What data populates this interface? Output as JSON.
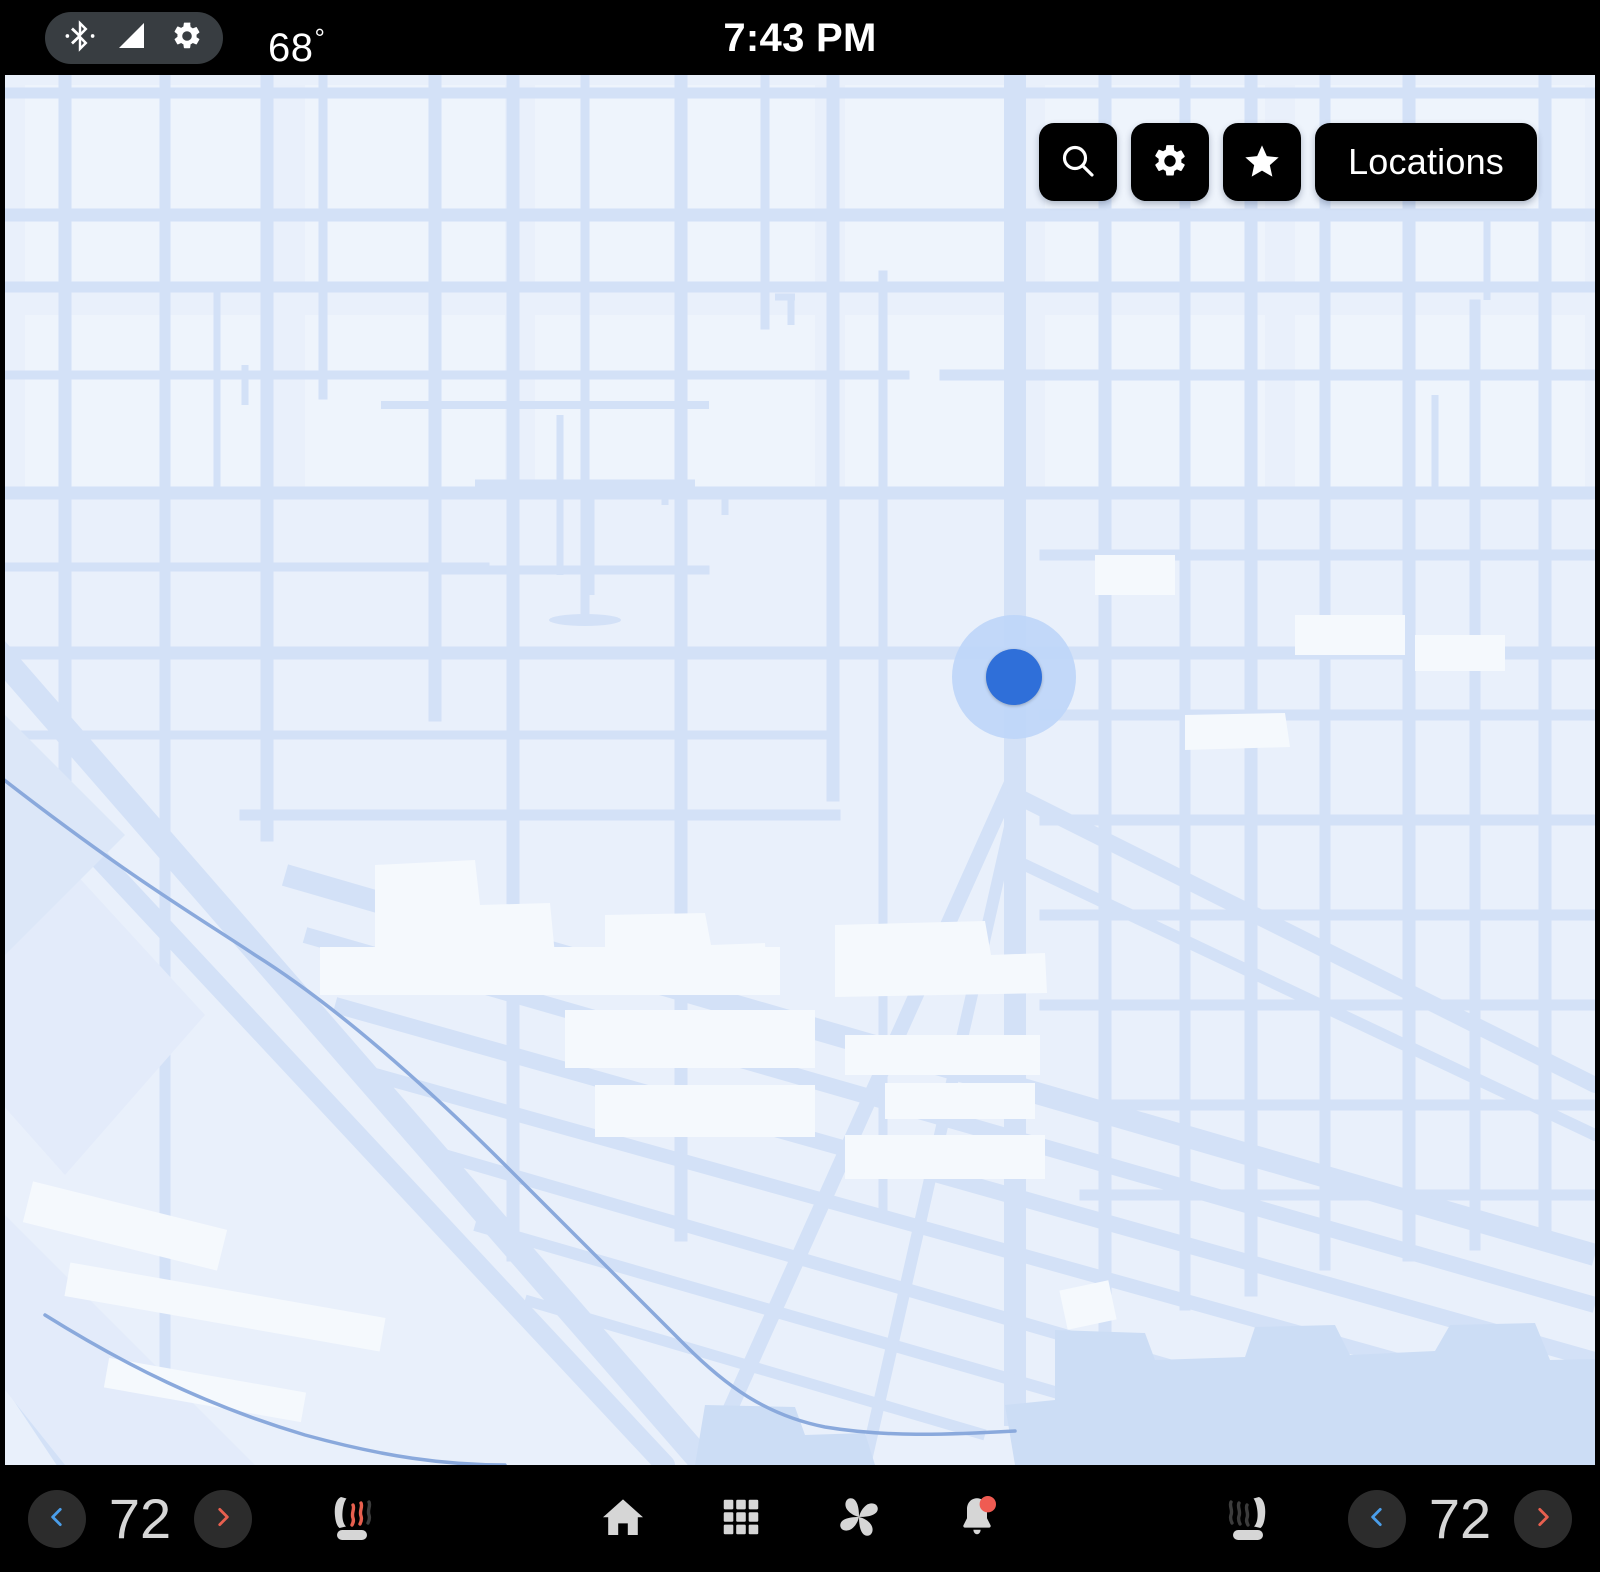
{
  "status_bar": {
    "icons": [
      "bluetooth-icon",
      "cell-signal-icon",
      "gear-icon"
    ],
    "outside_temperature": "68",
    "degree_symbol": "°",
    "clock": "7:43 PM"
  },
  "map": {
    "background_color": "#e9f0fb",
    "road_color": "#d3e1f7",
    "major_road_color": "#c9dbf5",
    "block_color": "#eef3fc",
    "building_color": "#f5f9fd",
    "water_color": "#ccddf5",
    "rail_line_color": "#7a9ed8",
    "marker": {
      "name": "current-location-marker",
      "dot_color": "#2f6fd9",
      "halo_color": "#bed6f8"
    },
    "toolbar": {
      "search_icon": "search-icon",
      "settings_icon": "gear-icon",
      "favorites_icon": "star-icon",
      "locations_label": "Locations"
    }
  },
  "bottom_bar": {
    "left_climate": {
      "decrease_label": "‹",
      "temperature": "72",
      "increase_label": "›",
      "decrease_color": "#4a9eea",
      "increase_color": "#e8604f",
      "seat_icon": "heated-seat-left-icon",
      "seat_heat_active": true,
      "seat_heat_color": "#e8604f"
    },
    "right_climate": {
      "decrease_label": "‹",
      "temperature": "72",
      "increase_label": "›",
      "decrease_color": "#4a9eea",
      "increase_color": "#e8604f",
      "seat_icon": "heated-seat-right-icon",
      "seat_heat_active": false,
      "seat_heat_color": "#3c3c3c"
    },
    "nav_items": [
      {
        "name": "home-icon",
        "label": "Home"
      },
      {
        "name": "apps-grid-icon",
        "label": "Apps"
      },
      {
        "name": "fan-icon",
        "label": "Climate"
      },
      {
        "name": "notifications-bell-icon",
        "label": "Notifications",
        "badge": true,
        "badge_color": "#ef5b52"
      }
    ]
  }
}
